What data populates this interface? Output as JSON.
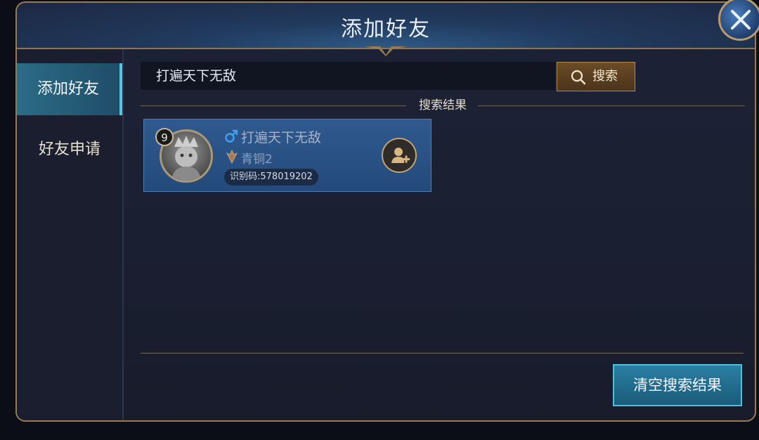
{
  "header": {
    "title": "添加好友"
  },
  "sidebar": {
    "items": [
      {
        "label": "添加好友",
        "active": true
      },
      {
        "label": "好友申请",
        "active": false
      }
    ]
  },
  "search": {
    "value": "打遍天下无敌",
    "button_label": "搜索"
  },
  "results": {
    "title": "搜索结果",
    "items": [
      {
        "level": "9",
        "gender": "male-icon",
        "name": "打遍天下无敌",
        "rank": "青铜2",
        "uid": "识别码:578019202"
      }
    ]
  },
  "footer": {
    "clear_button_label": "清空搜索结果"
  },
  "colors": {
    "accent_blue": "#4fc0d9",
    "gold_border": "#9a7c52",
    "card_blue": "#2f5a8f"
  }
}
